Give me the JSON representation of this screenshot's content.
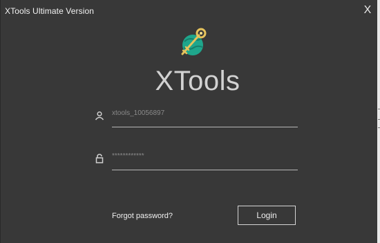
{
  "window": {
    "title": "XTools Ultimate Version",
    "close_label": "X"
  },
  "logo": {
    "icon": "key-globe-icon",
    "colors": {
      "globe": "#1fa68c",
      "key": "#e6c35c"
    }
  },
  "app_name": "XTools",
  "login_form": {
    "username": {
      "value": "xtools_10056897",
      "icon": "user-icon"
    },
    "password": {
      "value": "************",
      "icon": "lock-icon"
    },
    "forgot_label": "Forgot password?",
    "login_label": "Login"
  },
  "colors": {
    "background": "#383838",
    "text": "#f0f0f0",
    "muted_text": "#8a8a8a"
  }
}
